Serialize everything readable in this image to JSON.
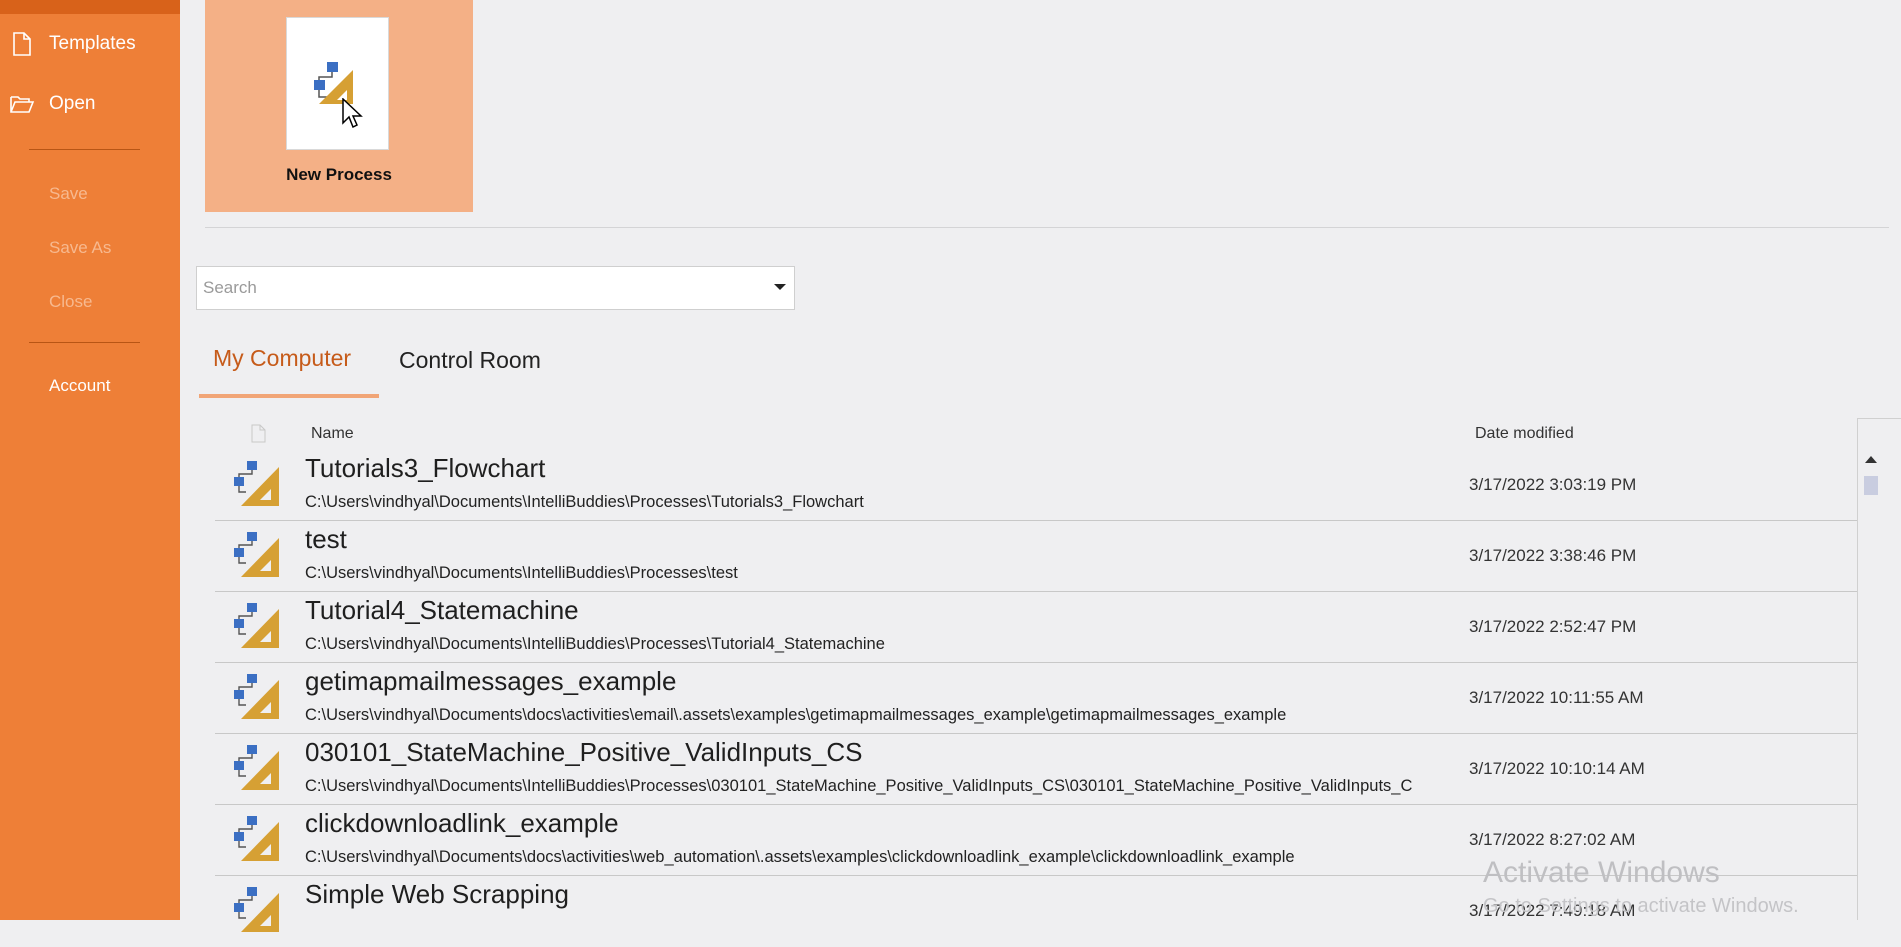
{
  "sidebar": {
    "items": [
      {
        "label": "Templates",
        "icon": "document-icon",
        "enabled": true
      },
      {
        "label": "Open",
        "icon": "folder-open-icon",
        "enabled": true
      },
      {
        "label": "Save",
        "enabled": false
      },
      {
        "label": "Save As",
        "enabled": false
      },
      {
        "label": "Close",
        "enabled": false
      },
      {
        "label": "Account",
        "enabled": true
      }
    ]
  },
  "new_process": {
    "label": "New Process",
    "icon": "process-flowchart-icon"
  },
  "search": {
    "placeholder": "Search"
  },
  "tabs": [
    {
      "label": "My Computer",
      "active": true
    },
    {
      "label": "Control Room",
      "active": false
    }
  ],
  "table": {
    "headers": {
      "name": "Name",
      "date": "Date modified"
    },
    "rows": [
      {
        "name": "Tutorials3_Flowchart",
        "path": "C:\\Users\\vindhyal\\Documents\\IntelliBuddies\\Processes\\Tutorials3_Flowchart",
        "date": "3/17/2022 3:03:19 PM"
      },
      {
        "name": "test",
        "path": "C:\\Users\\vindhyal\\Documents\\IntelliBuddies\\Processes\\test",
        "date": "3/17/2022 3:38:46 PM"
      },
      {
        "name": "Tutorial4_Statemachine",
        "path": "C:\\Users\\vindhyal\\Documents\\IntelliBuddies\\Processes\\Tutorial4_Statemachine",
        "date": "3/17/2022 2:52:47 PM"
      },
      {
        "name": "getimapmailmessages_example",
        "path": "C:\\Users\\vindhyal\\Documents\\docs\\activities\\email\\.assets\\examples\\getimapmailmessages_example\\getimapmailmessages_example",
        "date": "3/17/2022 10:11:55 AM"
      },
      {
        "name": "030101_StateMachine_Positive_ValidInputs_CS",
        "path": "C:\\Users\\vindhyal\\Documents\\IntelliBuddies\\Processes\\030101_StateMachine_Positive_ValidInputs_CS\\030101_StateMachine_Positive_ValidInputs_C",
        "date": "3/17/2022 10:10:14 AM"
      },
      {
        "name": "clickdownloadlink_example",
        "path": "C:\\Users\\vindhyal\\Documents\\docs\\activities\\web_automation\\.assets\\examples\\clickdownloadlink_example\\clickdownloadlink_example",
        "date": "3/17/2022 8:27:02 AM"
      },
      {
        "name": "Simple Web Scrapping",
        "path": "",
        "date": "3/17/2022 7:49:18 AM"
      }
    ]
  },
  "watermark": {
    "line1": "Activate Windows",
    "line2": "Go to Settings to activate Windows."
  },
  "colors": {
    "sidebar": "#ee7f37",
    "accent": "#c65b1a",
    "tile": "#f4b086",
    "background": "#efeff1"
  }
}
